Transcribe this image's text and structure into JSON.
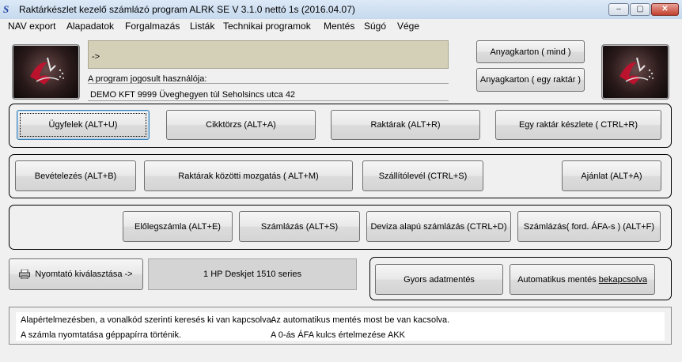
{
  "window": {
    "title": "Raktárkészlet kezelő számlázó program ALRK SE V 3.1.0  nettó 1s  (2016.04.07)",
    "app_icon": "S",
    "minimize": "–",
    "maximize": "▢",
    "close": "✕"
  },
  "menu": [
    "NAV export",
    "Alapadatok",
    "Forgalmazás",
    "Listák",
    "Technikai programok",
    "Mentés",
    "Súgó",
    "Vége"
  ],
  "header": {
    "status_text": "->",
    "licensed_user_label": "A program jogosult használója:",
    "licensed_user_value": "DEMO KFT 9999 Üveghegyen túl Seholsincs utca 42",
    "btn_anyagkarton_all": "Anyagkarton ( mind )",
    "btn_anyagkarton_one": "Anyagkarton ( egy raktár )",
    "logo_left": "ALRK logo",
    "logo_right": "ALRK logo"
  },
  "row1": {
    "ugyfelek": "Ügyfelek (ALT+U)",
    "cikktorzs": "Cikktörzs (ALT+A)",
    "raktarak": "Raktárak (ALT+R)",
    "egy_raktar": "Egy raktár készlete ( CTRL+R)"
  },
  "row2": {
    "bevetelezes": "Bevételezés (ALT+B)",
    "raktarak_mozgatas": "Raktárak közötti mozgatás ( ALT+M)",
    "szallitolevel": "Szállítólevél (CTRL+S)",
    "ajanlat": "Ajánlat (ALT+A)"
  },
  "row3": {
    "eloleg": "Előlegszámla (ALT+E)",
    "szamlazas": "Számlázás (ALT+S)",
    "deviza": "Deviza alapú számlázás (CTRL+D)",
    "ford_afa": "Számlázás( ford. ÁFA-s ) (ALT+F)"
  },
  "printer": {
    "select_button": "Nyomtató kiválasztása ->",
    "selected_value": "1 HP Deskjet 1510 series",
    "icon": "printer-icon"
  },
  "backup": {
    "quick_backup": "Gyors adatmentés",
    "auto_backup_prefix": "Automatikus mentés ",
    "auto_backup_ul": "bekapcsolva"
  },
  "info": {
    "line1_left": "Alapértelmezésben, a vonalkód szerinti keresés ki van kapcsolva.",
    "line1_right": "Az automatikus mentés most be van kacsolva.",
    "line2_left": "A számla nyomtatása géppapírra történik.",
    "line2_right": "A 0-ás ÁFA kulcs értelmezése AKK"
  },
  "colors": {
    "status_box": "#d4d0b8",
    "printer_field": "#d4d4d4",
    "title_gradient_top": "#dce9f7"
  }
}
